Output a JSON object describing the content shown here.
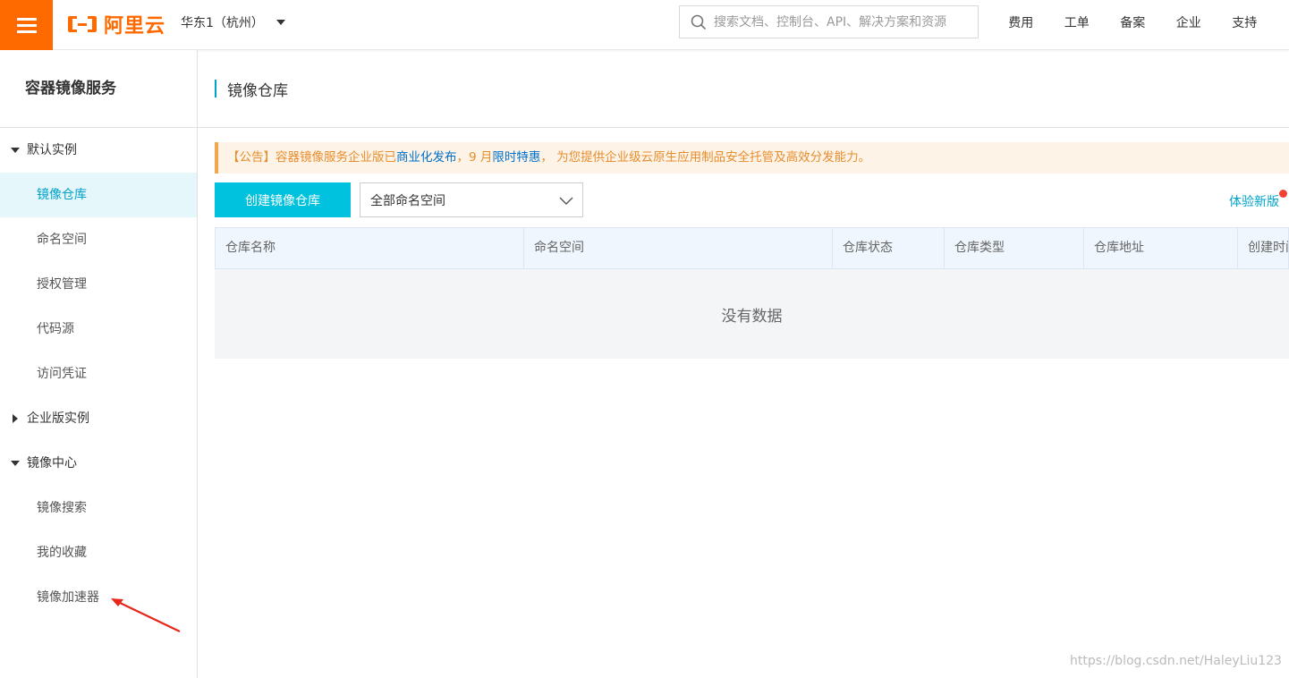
{
  "topbar": {
    "logo_text": "阿里云",
    "region": "华东1（杭州）",
    "search_placeholder": "搜索文档、控制台、API、解决方案和资源",
    "nav": [
      "费用",
      "工单",
      "备案",
      "企业",
      "支持"
    ],
    "nav_cut": "1",
    "brand_color": "#ff6a00"
  },
  "sidebar": {
    "title": "容器镜像服务",
    "groups": [
      {
        "label": "默认实例",
        "expanded": true,
        "items": [
          "镜像仓库",
          "命名空间",
          "授权管理",
          "代码源",
          "访问凭证"
        ]
      },
      {
        "label": "企业版实例",
        "expanded": false,
        "items": []
      },
      {
        "label": "镜像中心",
        "expanded": true,
        "items": [
          "镜像搜索",
          "我的收藏",
          "镜像加速器"
        ]
      }
    ],
    "active_item": "镜像仓库"
  },
  "main": {
    "page_title": "镜像仓库",
    "notice": {
      "prefix": "【公告】容器镜像服务企业版已",
      "link1": "商业化发布",
      "mid": "，9 月",
      "link2": "限时特惠",
      "suffix": "， 为您提供企业级云原生应用制品安全托管及高效分发能力。"
    },
    "create_button": "创建镜像仓库",
    "namespace_select": "全部命名空间",
    "try_new": "体验新版",
    "table": {
      "columns": [
        "仓库名称",
        "命名空间",
        "仓库状态",
        "仓库类型",
        "仓库地址",
        "创建时间"
      ],
      "empty_text": "没有数据"
    }
  },
  "watermark": "https://blog.csdn.net/HaleyLiu123",
  "accent_color": "#00c1de"
}
